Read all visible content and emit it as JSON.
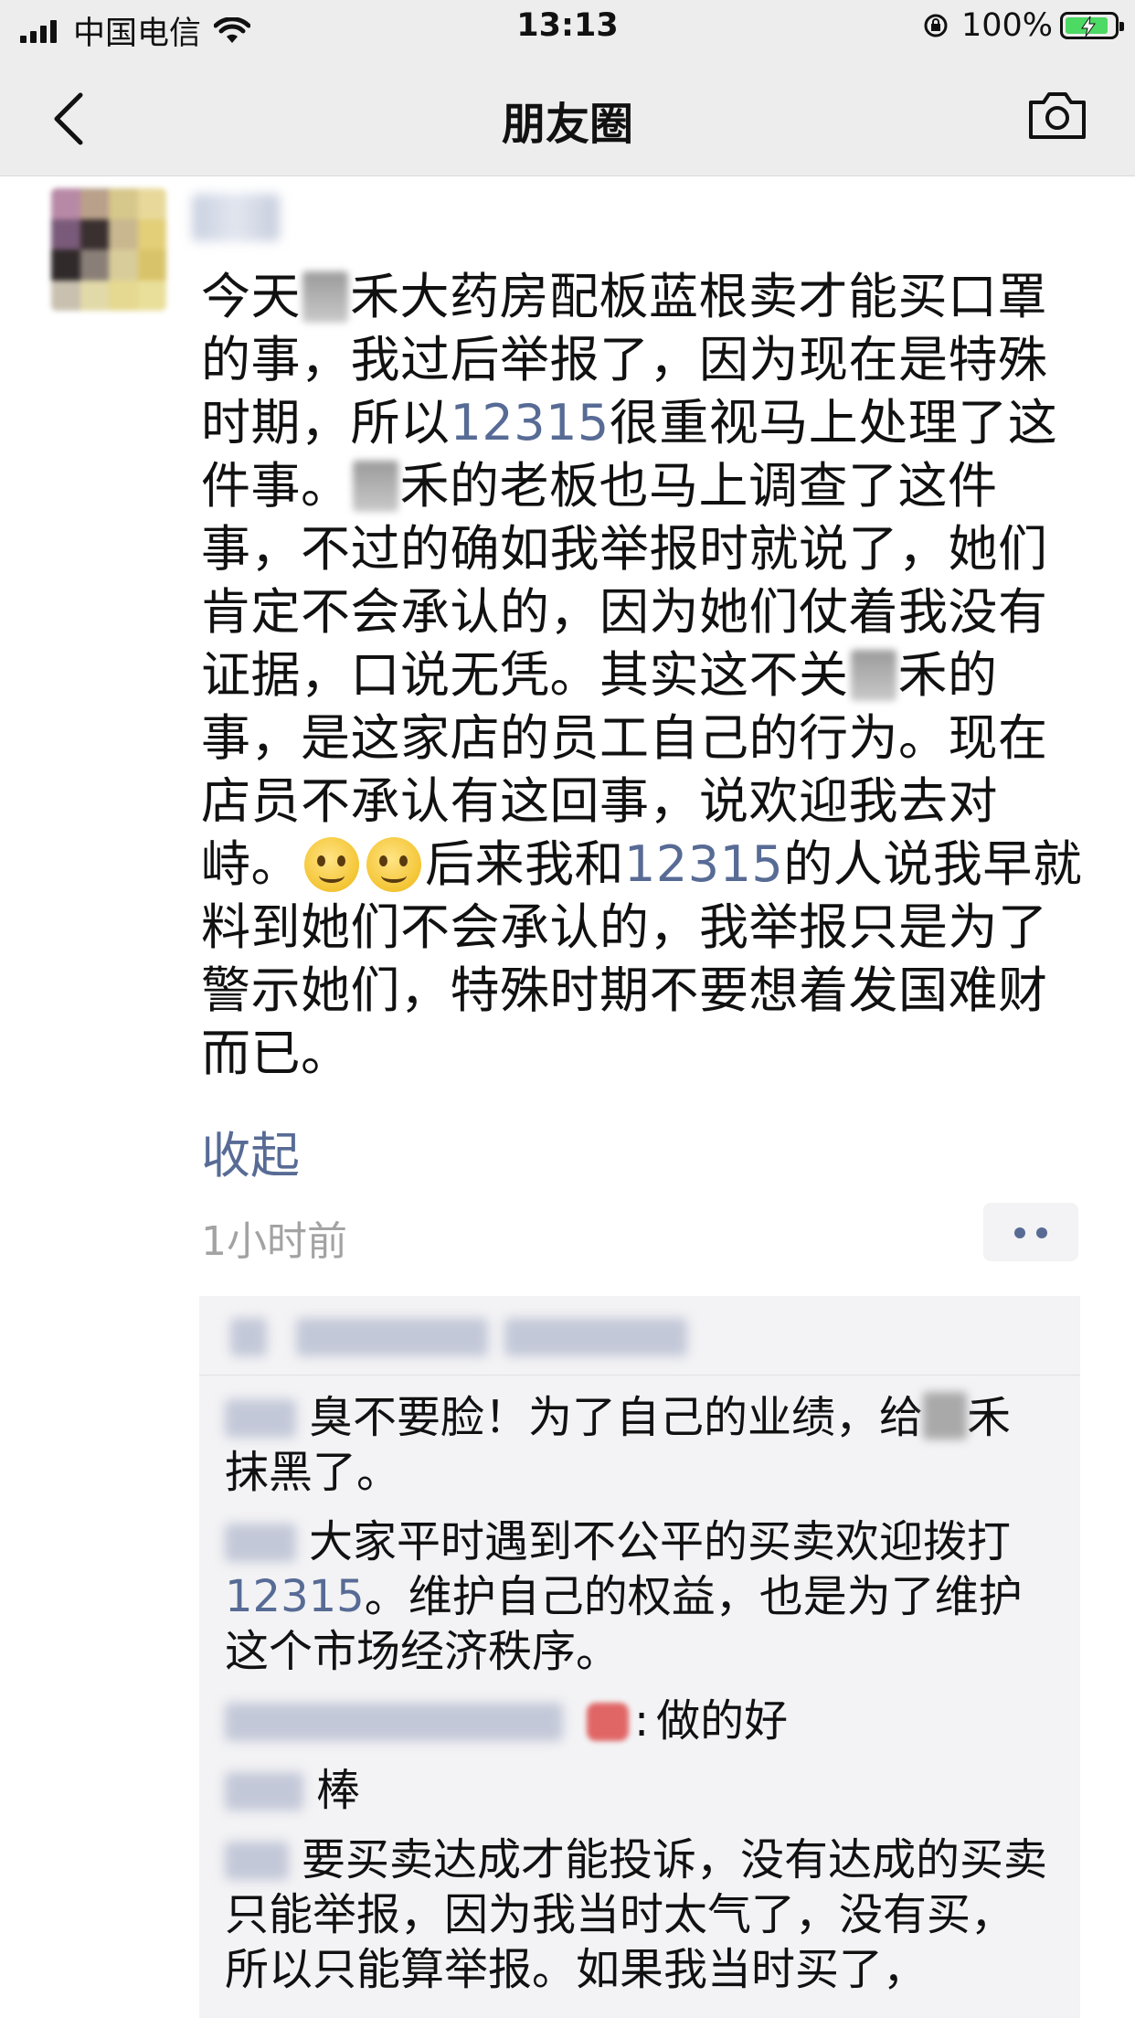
{
  "status_bar": {
    "carrier": "中国电信",
    "time": "13:13",
    "battery": "100%"
  },
  "nav": {
    "title": "朋友圈"
  },
  "post": {
    "lines": [
      [
        "今天",
        "",
        "禾大药房配板蓝根卖才能买口罩"
      ],
      [
        "的事，我过后举报了，因为现在是特殊"
      ],
      [
        "时期，所以",
        "12315",
        "很重视马上处理了这"
      ],
      [
        "件事。",
        "",
        "禾的老板也马上调查了这件"
      ],
      [
        "事，不过的确如我举报时就说了，她们"
      ],
      [
        "肯定不会承认的，因为她们仗着我没有"
      ],
      [
        "证据，口说无凭。其实这不关",
        "",
        "禾的"
      ],
      [
        "事，是这家店的员工自己的行为。现在"
      ],
      [
        "店员不承认有这回事，说欢迎我去对"
      ],
      [
        "峙。",
        "",
        "后来我和",
        "12315",
        "的人说我早就"
      ],
      [
        "料到她们不会承认的，我举报只是为了"
      ],
      [
        "警示她们，特殊时期不要想着发国难财"
      ],
      [
        "而已。"
      ]
    ],
    "collapse_label": "收起",
    "time_ago": "1小时前"
  },
  "comments": [
    {
      "text_a": "臭不要脸！为了自己的业绩，给",
      "text_b": "禾",
      "text_c": "抹黑了。"
    },
    {
      "text_a": "大家平时遇到不公平的买卖欢迎拨打",
      "link": "12315",
      "text_c": "。维护自己的权益，也是为了维护这个市场经济秩序。"
    },
    {
      "colon": ":",
      "text": "做的好"
    },
    {
      "text": "棒"
    },
    {
      "text": "要买卖达成才能投诉，没有达成的买卖只能举报，因为我当时太气了，没有买，所以只能算举报。如果我当时买了，"
    }
  ],
  "colors": {
    "link": "#576b95",
    "bar_bg": "#ededed",
    "comment_bg": "#f3f3f5"
  }
}
